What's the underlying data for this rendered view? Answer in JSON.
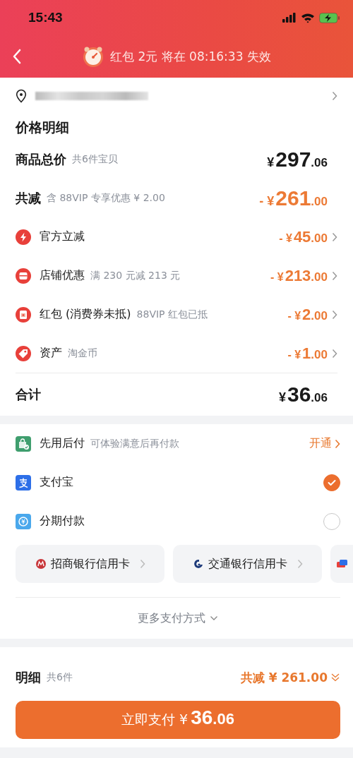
{
  "status_bar": {
    "time": "15:43"
  },
  "header": {
    "countdown": "红包 2元 将在 08:16:33 失效"
  },
  "address": {
    "redacted": true
  },
  "price_detail": {
    "title": "价格明细",
    "summary": [
      {
        "label": "商品总价",
        "note": "共6件宝贝",
        "price": {
          "prefix": "¥",
          "whole": "297",
          "fraction": ".06"
        },
        "discount": false
      },
      {
        "label": "共减",
        "note": "含 88VIP 专享优惠 ¥ 2.00",
        "price": {
          "prefix": "- ¥",
          "whole": "261",
          "fraction": ".00"
        },
        "discount": true
      }
    ],
    "items": [
      {
        "kind": "bolt",
        "label": "官方立减",
        "price": {
          "prefix": "- ¥",
          "whole": "45",
          "fraction": ".00"
        }
      },
      {
        "kind": "shop",
        "label": "店铺优惠",
        "note": "满 230 元减 213 元",
        "price": {
          "prefix": "- ¥",
          "whole": "213",
          "fraction": ".00"
        }
      },
      {
        "kind": "envelope",
        "label": "红包 (消费券未抵)",
        "note": "88VIP 红包已抵",
        "price": {
          "prefix": "- ¥",
          "whole": "2",
          "fraction": ".00"
        }
      },
      {
        "kind": "tag",
        "label": "资产",
        "note": "淘金币",
        "price": {
          "prefix": "- ¥",
          "whole": "1",
          "fraction": ".00"
        }
      }
    ],
    "total": {
      "label": "合计",
      "price": {
        "prefix": "¥",
        "whole": "36",
        "fraction": ".06"
      }
    }
  },
  "payment": {
    "pay_later": {
      "label": "先用后付",
      "note": "可体验满意后再付款",
      "action": "开通"
    },
    "methods": [
      {
        "kind": "alipay",
        "label": "支付宝",
        "selected": true
      },
      {
        "kind": "installment",
        "label": "分期付款",
        "selected": false
      }
    ],
    "cards": [
      {
        "kind": "cmb",
        "label": "招商银行信用卡"
      },
      {
        "kind": "bocom",
        "label": "交通银行信用卡"
      },
      {
        "kind": "other"
      }
    ],
    "more": "更多支付方式"
  },
  "footer": {
    "label": "明细",
    "count": "共6件",
    "saving": "共减 ¥ 261.00",
    "pay_button": {
      "label": "立即支付 ¥",
      "whole": "36",
      "fraction": ".06"
    }
  }
}
